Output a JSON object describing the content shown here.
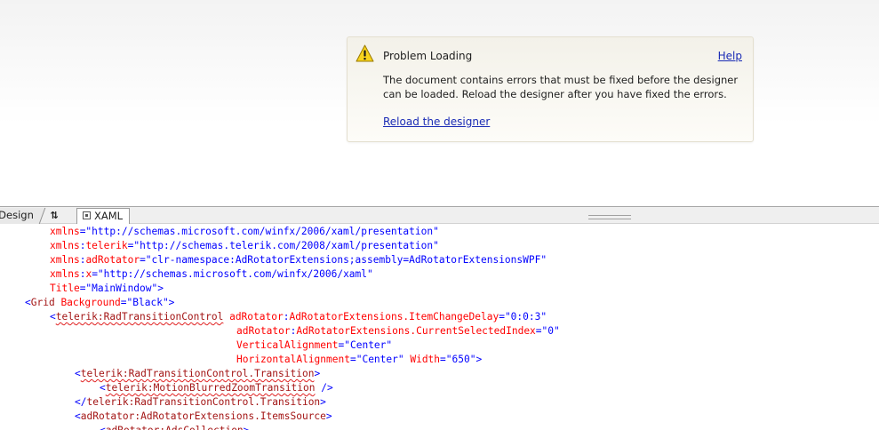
{
  "designer": {
    "problem": {
      "title": "Problem Loading",
      "help_label": "Help",
      "message": "The document contains errors that must be fixed before the designer can be loaded. Reload the designer after you have fixed the errors.",
      "reload_label": "Reload the designer",
      "icon": "warning-icon"
    }
  },
  "tabs": {
    "design_label": "Design",
    "swap_label": "⇅",
    "xaml_label": "XAML"
  },
  "editor": {
    "lines": [
      {
        "indent": 56,
        "tokens": [
          {
            "t": "xmlns",
            "c": "attr"
          },
          {
            "t": "=\"http://schemas.microsoft.com/winfx/2006/xaml/presentation\"",
            "c": "val"
          }
        ]
      },
      {
        "indent": 56,
        "tokens": [
          {
            "t": "xmlns",
            "c": "attr"
          },
          {
            "t": ":",
            "c": "punc"
          },
          {
            "t": "telerik",
            "c": "attr"
          },
          {
            "t": "=\"http://schemas.telerik.com/2008/xaml/presentation\"",
            "c": "val"
          }
        ]
      },
      {
        "indent": 56,
        "tokens": [
          {
            "t": "xmlns",
            "c": "attr"
          },
          {
            "t": ":",
            "c": "punc"
          },
          {
            "t": "adRotator",
            "c": "attr"
          },
          {
            "t": "=\"clr-namespace:AdRotatorExtensions;assembly=AdRotatorExtensionsWPF\"",
            "c": "val"
          }
        ]
      },
      {
        "indent": 56,
        "tokens": [
          {
            "t": "xmlns",
            "c": "attr"
          },
          {
            "t": ":",
            "c": "punc"
          },
          {
            "t": "x",
            "c": "attr"
          },
          {
            "t": "=\"http://schemas.microsoft.com/winfx/2006/xaml\"",
            "c": "val"
          }
        ]
      },
      {
        "indent": 56,
        "tokens": [
          {
            "t": "Title",
            "c": "attr"
          },
          {
            "t": "=\"MainWindow\">",
            "c": "val"
          }
        ]
      },
      {
        "indent": 28,
        "tokens": [
          {
            "t": "<",
            "c": "punc"
          },
          {
            "t": "Grid",
            "c": "tag"
          },
          {
            "t": " Background",
            "c": "attr"
          },
          {
            "t": "=\"Black\">",
            "c": "val"
          }
        ]
      },
      {
        "indent": 56,
        "tokens": [
          {
            "t": "<",
            "c": "punc"
          },
          {
            "t": "telerik:RadTransitionControl",
            "c": "tag",
            "squig": true
          },
          {
            "t": " adRotator",
            "c": "attr"
          },
          {
            "t": ":",
            "c": "punc"
          },
          {
            "t": "AdRotatorExtensions.ItemChangeDelay",
            "c": "attr"
          },
          {
            "t": "=\"0:0:3\"",
            "c": "val"
          }
        ]
      },
      {
        "indent": 266,
        "tokens": [
          {
            "t": "adRotator",
            "c": "attr"
          },
          {
            "t": ":",
            "c": "punc"
          },
          {
            "t": "AdRotatorExtensions.CurrentSelectedIndex",
            "c": "attr"
          },
          {
            "t": "=\"0\"",
            "c": "val"
          }
        ]
      },
      {
        "indent": 266,
        "tokens": [
          {
            "t": "VerticalAlignment",
            "c": "attr"
          },
          {
            "t": "=\"Center\"",
            "c": "val"
          }
        ]
      },
      {
        "indent": 266,
        "tokens": [
          {
            "t": "HorizontalAlignment",
            "c": "attr"
          },
          {
            "t": "=\"Center\"",
            "c": "val"
          },
          {
            "t": " Width",
            "c": "attr"
          },
          {
            "t": "=\"650\">",
            "c": "val"
          }
        ]
      },
      {
        "indent": 84,
        "tokens": [
          {
            "t": "<",
            "c": "punc"
          },
          {
            "t": "telerik:RadTransitionControl.Transition",
            "c": "tag",
            "squig": true
          },
          {
            "t": ">",
            "c": "punc"
          }
        ]
      },
      {
        "indent": 112,
        "tokens": [
          {
            "t": "<",
            "c": "punc"
          },
          {
            "t": "telerik:MotionBlurredZoomTransition",
            "c": "tag",
            "squig": true
          },
          {
            "t": " />",
            "c": "punc"
          }
        ]
      },
      {
        "indent": 84,
        "tokens": [
          {
            "t": "</",
            "c": "punc"
          },
          {
            "t": "telerik:RadTransitionControl.Transition",
            "c": "tag"
          },
          {
            "t": ">",
            "c": "punc"
          }
        ]
      },
      {
        "indent": 84,
        "tokens": [
          {
            "t": "<",
            "c": "punc"
          },
          {
            "t": "adRotator:AdRotatorExtensions.ItemsSource",
            "c": "tag"
          },
          {
            "t": ">",
            "c": "punc"
          }
        ]
      },
      {
        "indent": 112,
        "tokens": [
          {
            "t": "<",
            "c": "punc"
          },
          {
            "t": "adRotator:AdsCollection",
            "c": "tag"
          },
          {
            "t": ">",
            "c": "punc"
          }
        ]
      }
    ]
  }
}
